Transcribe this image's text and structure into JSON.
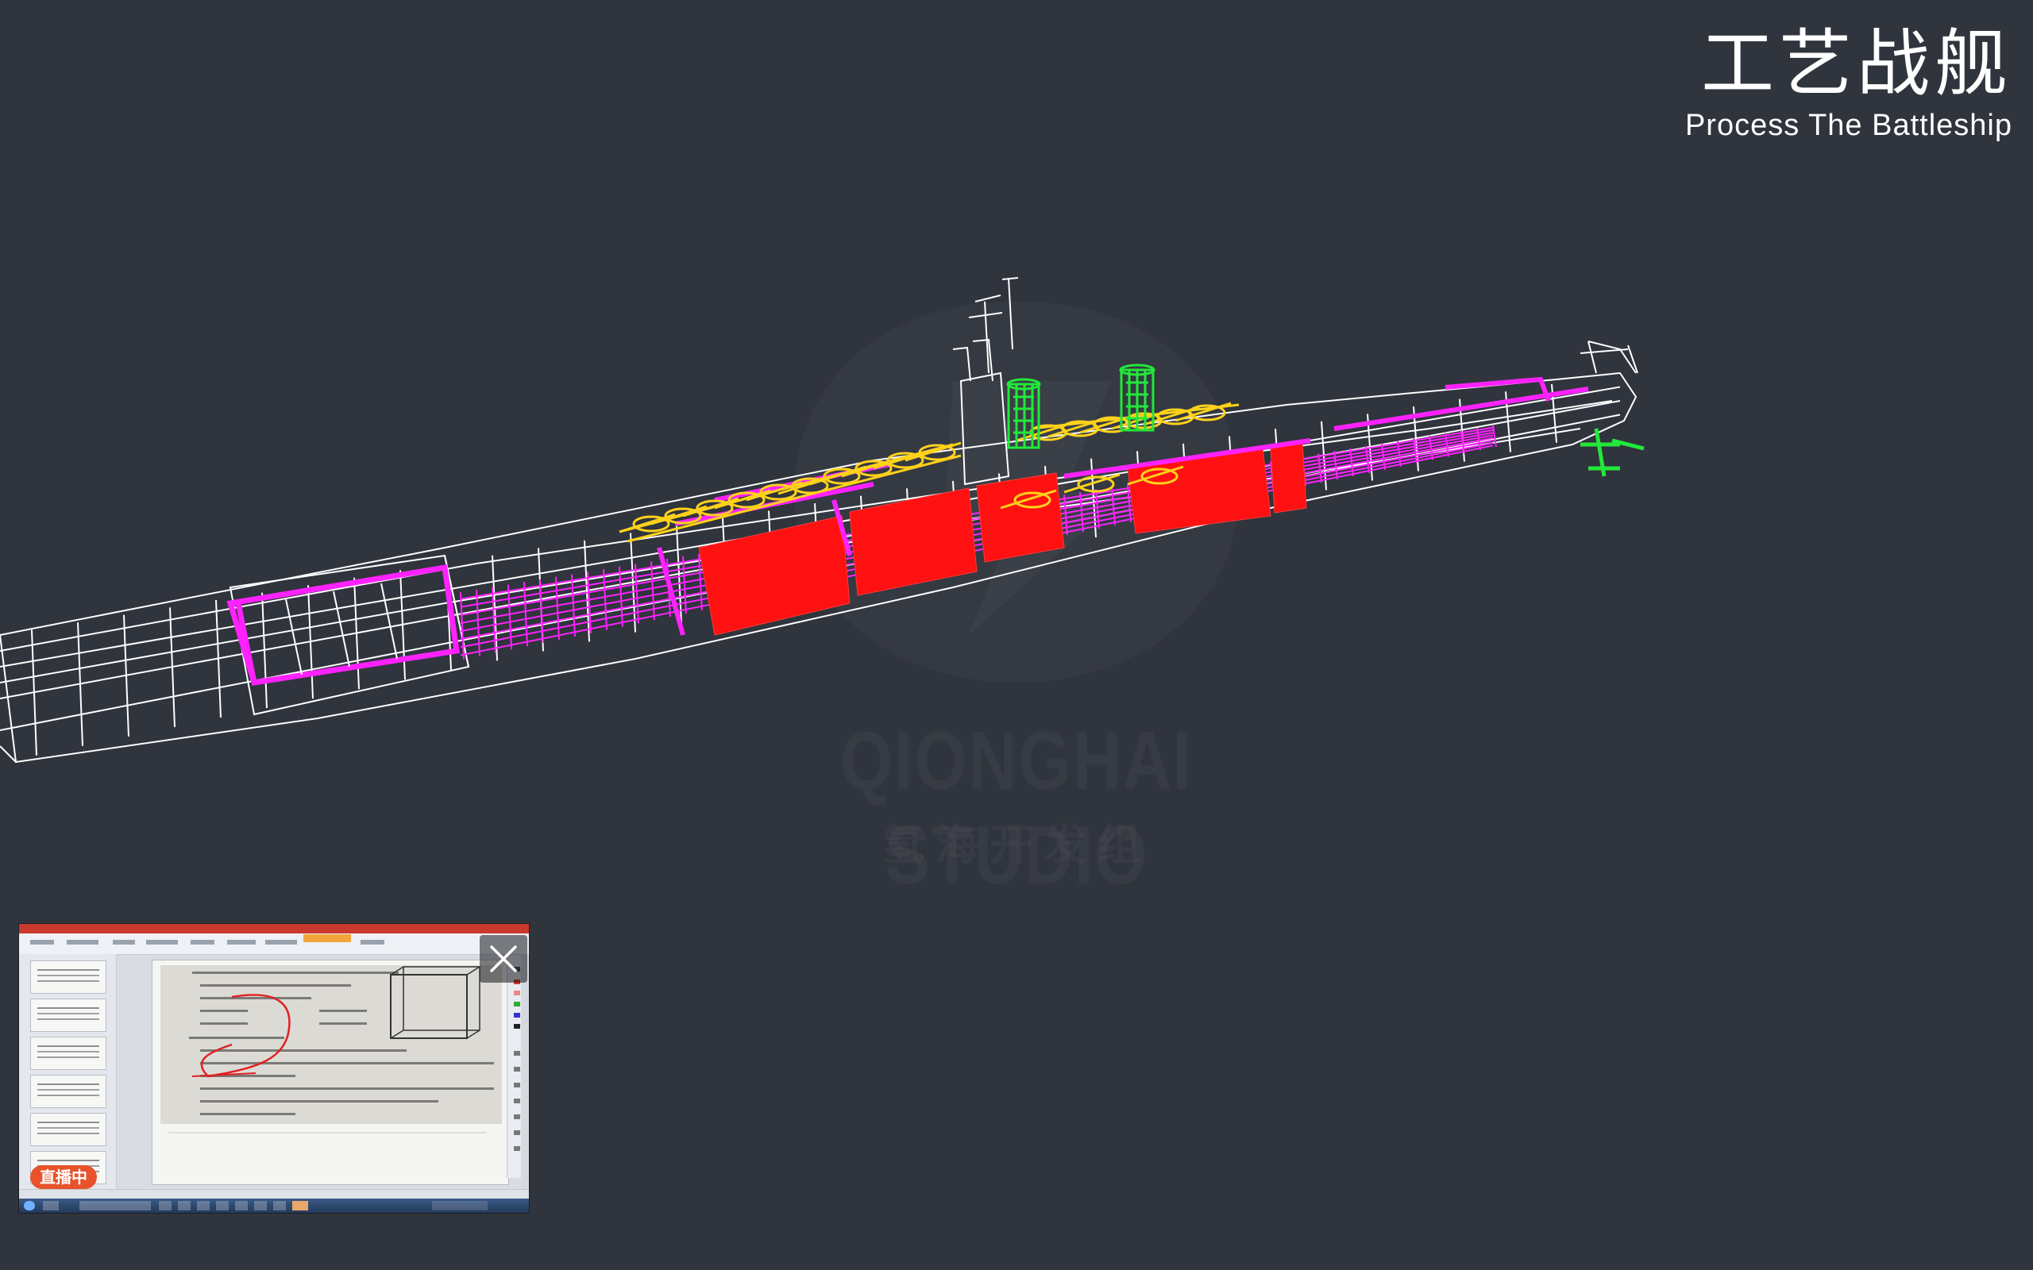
{
  "brand": {
    "title": "工艺战舰",
    "subtitle": "Process The Battleship"
  },
  "watermark": {
    "text": "QIONGHAI STUDIO",
    "subtext": "氢海开发组"
  },
  "colors": {
    "background": "#30343d",
    "hull_wire": "#ffffff",
    "frame_magenta": "#ff22ff",
    "machinery_red": "#ff1111",
    "gear_yellow": "#ffd21a",
    "stack_green": "#22e83a",
    "live_badge": "#e8532b"
  },
  "pip": {
    "live_badge": "直播中",
    "close_icon": "close-icon"
  }
}
